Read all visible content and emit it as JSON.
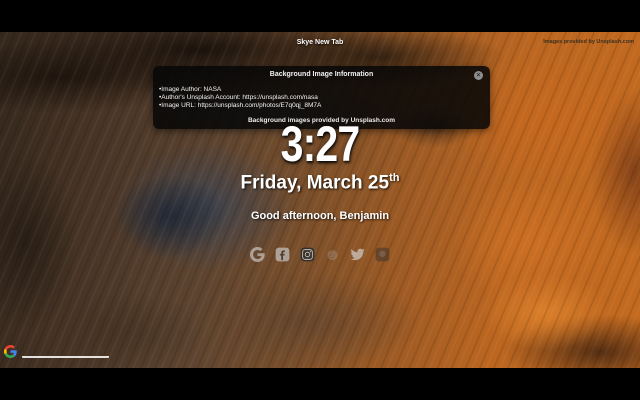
{
  "page": {
    "title": "Skye New Tab",
    "images_credit": "Images provided by Unsplash.com"
  },
  "info_popup": {
    "title": "Background Image Information",
    "close_glyph": "✕",
    "lines": [
      "•Image Author: NASA",
      "•Author's Unsplash Account: https://unsplash.com/nasa",
      "•Image URL: https://unsplash.com/photos/E7q0qj_8M7A"
    ],
    "footer": "Background images provided by Unsplash.com"
  },
  "clock": {
    "time": "3:27"
  },
  "date": {
    "text": "Friday, March 25",
    "ordinal_suffix": "th"
  },
  "greeting": {
    "text": "Good afternoon, Benjamin"
  },
  "social": {
    "icons": [
      "google-icon",
      "facebook-icon",
      "instagram-icon",
      "reddit-icon",
      "twitter-icon",
      "github-icon"
    ]
  },
  "search": {
    "engine_logo": "google-logo-icon",
    "query_value": ""
  },
  "colors": {
    "terrain_orange": "#c36a1f",
    "crater_blue": "#38445c",
    "popup_bg": "rgba(7,7,7,0.88)",
    "letterbox": "#000000"
  }
}
